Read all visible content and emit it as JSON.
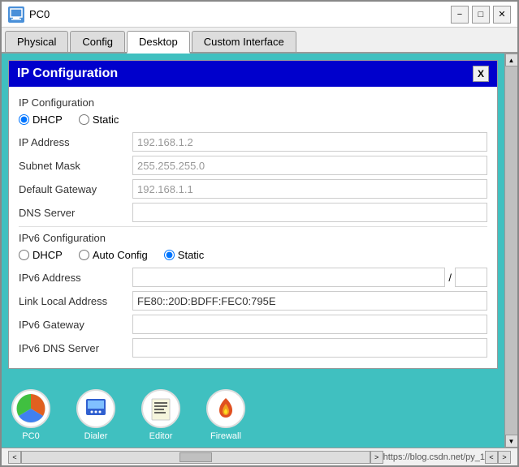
{
  "window": {
    "title": "PC0",
    "icon": "PC"
  },
  "title_buttons": {
    "minimize": "−",
    "maximize": "□",
    "close": "✕"
  },
  "tabs": [
    {
      "label": "Physical",
      "active": false
    },
    {
      "label": "Config",
      "active": false
    },
    {
      "label": "Desktop",
      "active": true
    },
    {
      "label": "Custom Interface",
      "active": false
    }
  ],
  "ip_config": {
    "header_title": "IP Configuration",
    "close_btn": "X",
    "section_ipv4": "IP Configuration",
    "dhcp_label": "DHCP",
    "static_label": "Static",
    "ipv4_selected": "DHCP",
    "fields": [
      {
        "label": "IP Address",
        "value": "192.168.1.2",
        "placeholder": "192.168.1.2",
        "editable": false
      },
      {
        "label": "Subnet Mask",
        "value": "255.255.255.0",
        "placeholder": "255.255.255.0",
        "editable": false
      },
      {
        "label": "Default Gateway",
        "value": "192.168.1.1",
        "placeholder": "192.168.1.1",
        "editable": false
      },
      {
        "label": "DNS Server",
        "value": "",
        "placeholder": "",
        "editable": true
      }
    ],
    "section_ipv6": "IPv6 Configuration",
    "ipv6_dhcp_label": "DHCP",
    "ipv6_auto_label": "Auto Config",
    "ipv6_static_label": "Static",
    "ipv6_selected": "Static",
    "ipv6_fields": [
      {
        "label": "IPv6 Address",
        "value": "",
        "placeholder": "",
        "editable": true,
        "has_prefix": true,
        "prefix_value": ""
      },
      {
        "label": "Link Local Address",
        "value": "FE80::20D:BDFF:FEC0:795E",
        "editable": false
      },
      {
        "label": "IPv6 Gateway",
        "value": "",
        "editable": true
      },
      {
        "label": "IPv6 DNS Server",
        "value": "",
        "editable": true
      }
    ]
  },
  "bottom_icons": [
    {
      "label": "Dialer",
      "icon": "dialer"
    },
    {
      "label": "Editor",
      "icon": "editor"
    },
    {
      "label": "Firewall",
      "icon": "firewall"
    }
  ],
  "status_bar": {
    "url": "https://blog.csdn.net/py_1",
    "scroll_arrows": [
      "<",
      ">"
    ]
  }
}
